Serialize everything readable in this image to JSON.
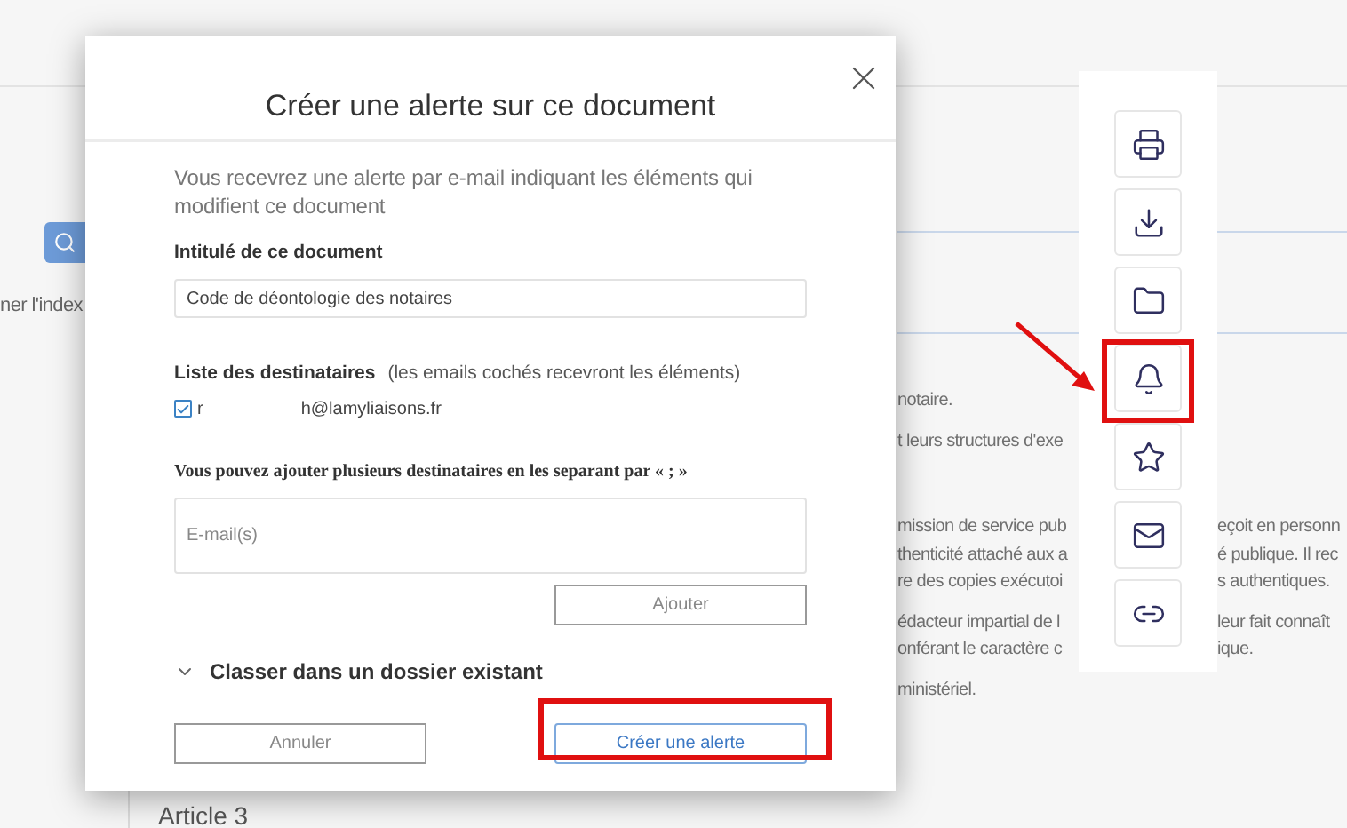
{
  "background": {
    "left_link": "ner l'index",
    "paragraphs": [
      [
        {
          "left": "notaire."
        }
      ],
      [
        {
          "left": "t leurs structures d'exe"
        }
      ],
      [
        {
          "left": "mission de service pub",
          "right": "eçoit en personn"
        },
        {
          "left": "thenticité attaché aux a",
          "right": "é publique. Il rec"
        },
        {
          "left": "re des copies exécutoi",
          "right": "s authentiques."
        }
      ],
      [
        {
          "left": "édacteur impartial de l",
          "right": "leur fait connaît"
        },
        {
          "left": "onférant le caractère c",
          "right": "ique."
        }
      ],
      [
        {
          "left": "ministériel."
        }
      ]
    ],
    "heading": "Article 3"
  },
  "dialog": {
    "title": "Créer une alerte sur ce document",
    "description": "Vous recevrez une alerte par e-mail indiquant les éléments qui modifient ce document",
    "title_field": {
      "label": "Intitulé de ce document",
      "value": "Code de déontologie des notaires"
    },
    "recipients": {
      "label": "Liste des destinataires",
      "note": "(les emails cochés recevront les éléments)",
      "items": [
        {
          "checked": true,
          "email_start": "r",
          "email_end": "h@lamyliaisons.fr"
        }
      ]
    },
    "add_hint": "Vous pouvez ajouter plusieurs destinataires en les separant par « ; »",
    "email_field": {
      "placeholder": "E-mail(s)"
    },
    "add_button": "Ajouter",
    "folder_section": {
      "label": "Classer dans un dossier existant",
      "expanded": false
    },
    "buttons": {
      "cancel": "Annuler",
      "submit": "Créer une alerte"
    }
  }
}
